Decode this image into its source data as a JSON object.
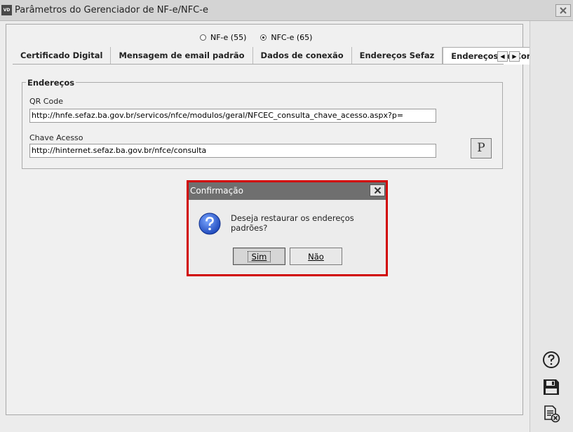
{
  "window": {
    "app_icon": "VD",
    "title": "Parâmetros do Gerenciador de NF-e/NFC-e"
  },
  "model_options": [
    {
      "label": "NF-e (55)",
      "selected": false
    },
    {
      "label": "NFC-e (65)",
      "selected": true
    }
  ],
  "tabs": [
    {
      "label": "Certificado Digital"
    },
    {
      "label": "Mensagem de email padrão"
    },
    {
      "label": "Dados de conexão"
    },
    {
      "label": "Endereços Sefaz"
    },
    {
      "label": "Endereços de Consulta",
      "active": true
    }
  ],
  "enderecos": {
    "group_title": "Endereços",
    "qr_code_label": "QR Code",
    "qr_code_value": "http://hnfe.sefaz.ba.gov.br/servicos/nfce/modulos/geral/NFCEC_consulta_chave_acesso.aspx?p=",
    "chave_label": "Chave Acesso",
    "chave_value": "http://hinternet.sefaz.ba.gov.br/nfce/consulta",
    "restore_button": "P"
  },
  "side_toolbar": [
    "help-icon",
    "save-icon",
    "close-document-icon"
  ],
  "dialog": {
    "title": "Confirmação",
    "message": "Deseja restaurar os endereços padrões?",
    "yes_label": "Sim",
    "no_label": "Não",
    "icon": "question-icon",
    "highlight_color": "#d10000"
  }
}
